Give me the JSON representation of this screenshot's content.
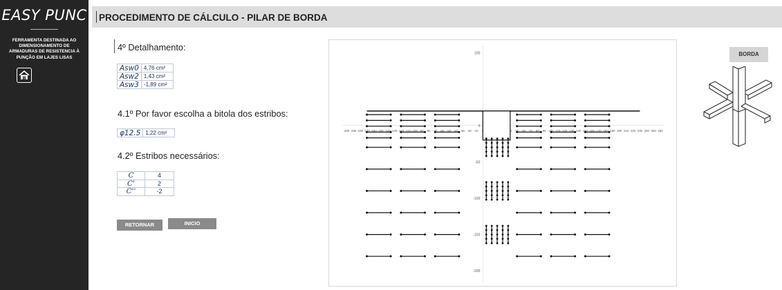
{
  "app": {
    "brand": "EASY PUNC",
    "tagline": "FERRAMENTA DESTINADA AO DIMENSIONAMENTO DE ARMADURAS DE RESISTENCIA À PUNÇÃO EM LAJES LISAS",
    "home_icon": "home-icon"
  },
  "header": {
    "title": "PROCEDIMENTO DE CÁLCULO - PILAR DE BORDA"
  },
  "detalhamento": {
    "title": "4º Detalhamento:",
    "rows": [
      {
        "label": "Asw0",
        "value": "4,76 cm²"
      },
      {
        "label": "Asw2",
        "value": "1,43 cm²"
      },
      {
        "label": "Asw3",
        "value": "-1,89 cm²"
      }
    ]
  },
  "bitola": {
    "title": "4.1º Por favor escolha a bitola dos estribos:",
    "label": "φ12.5",
    "value": "1,22 cm²"
  },
  "estribos": {
    "title": "4.2º Estribos necessários:",
    "rows": [
      {
        "label": "C",
        "value": "4"
      },
      {
        "label": "C'",
        "value": "2"
      },
      {
        "label": "C''",
        "value": "-2"
      }
    ]
  },
  "buttons": {
    "retornar": "RETORNAR",
    "inicio": "INICIO",
    "borda": "BORDA"
  },
  "chart_data": {
    "type": "scatter",
    "title": "",
    "xlabel": "",
    "ylabel": "",
    "x_ticks": [
      -200,
      -190,
      -180,
      -170,
      -160,
      -150,
      -140,
      -130,
      -120,
      -110,
      -100,
      -90,
      -80,
      -70,
      -60,
      -50,
      -40,
      -30,
      -20,
      -10,
      0,
      10,
      20,
      30,
      40,
      50,
      60,
      70,
      80,
      90,
      100,
      110,
      120,
      130,
      140,
      150,
      160,
      170,
      180,
      190,
      200,
      210,
      220,
      230,
      240,
      250,
      260
    ],
    "y_ticks": [
      100,
      0,
      -50,
      -100,
      -150,
      -200
    ],
    "xlim": [
      -205,
      265
    ],
    "ylim": [
      -215,
      110
    ],
    "grid": false,
    "slab_edge_y": 20,
    "pillar": {
      "x": [
        0,
        40
      ],
      "y": [
        -20,
        20
      ]
    },
    "horizontal_stirrup_rows_y_above": [
      15,
      7,
      -1,
      -9,
      -17
    ],
    "horizontal_stirrup_rows_y_below": [
      -30,
      -60,
      -90,
      -120,
      -150,
      -180
    ],
    "horizontal_segments_x": [
      [
        -170,
        -135
      ],
      [
        -120,
        -85
      ],
      [
        -70,
        -35
      ],
      [
        50,
        85
      ],
      [
        100,
        135
      ],
      [
        150,
        185
      ]
    ],
    "vertical_stirrup_groups_y": [
      [
        -18,
        -42
      ],
      [
        -78,
        -102
      ],
      [
        -138,
        -162
      ]
    ],
    "vertical_stirrup_lines_x": [
      5,
      13,
      21,
      29,
      37
    ]
  }
}
